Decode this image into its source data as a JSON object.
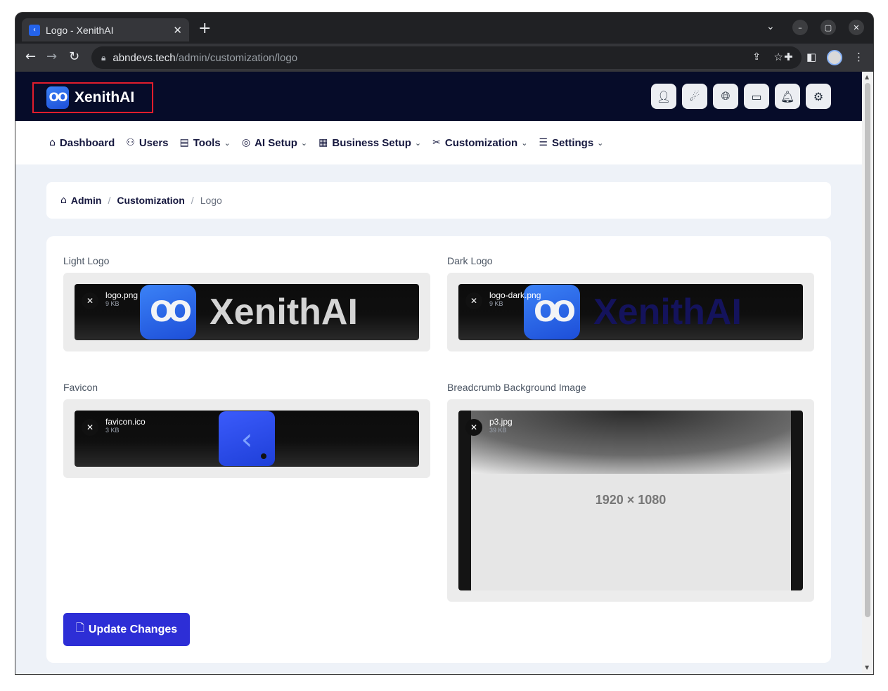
{
  "browser": {
    "tab_title": "Logo - XenithAI",
    "tab_close": "✕",
    "new_tab": "+",
    "url_host": "abndevs.tech",
    "url_path": "/admin/customization/logo"
  },
  "app": {
    "brand_mark": "OO",
    "brand_name": "XenithAI",
    "header_icons": [
      "user-icon",
      "theme-icon",
      "globe-icon",
      "currency-icon",
      "bell-icon",
      "user-settings-icon"
    ]
  },
  "nav": {
    "items": [
      {
        "label": "Dashboard",
        "icon": "home-icon",
        "dropdown": false
      },
      {
        "label": "Users",
        "icon": "users-icon",
        "dropdown": false
      },
      {
        "label": "Tools",
        "icon": "briefcase-icon",
        "dropdown": true
      },
      {
        "label": "AI Setup",
        "icon": "gauge-icon",
        "dropdown": true
      },
      {
        "label": "Business Setup",
        "icon": "building-icon",
        "dropdown": true
      },
      {
        "label": "Customization",
        "icon": "tools-icon",
        "dropdown": true
      },
      {
        "label": "Settings",
        "icon": "sliders-icon",
        "dropdown": true
      }
    ]
  },
  "breadcrumb": {
    "admin": "Admin",
    "customization": "Customization",
    "current": "Logo",
    "separator": "/"
  },
  "form": {
    "light_logo": {
      "label": "Light Logo",
      "file_name": "logo.png",
      "file_size": "9 KB",
      "preview_text": "XenithAI"
    },
    "dark_logo": {
      "label": "Dark Logo",
      "file_name": "logo-dark.png",
      "file_size": "9 KB",
      "preview_text": "XenithAI"
    },
    "favicon": {
      "label": "Favicon",
      "file_name": "favicon.ico",
      "file_size": "3 KB"
    },
    "breadcrumb_bg": {
      "label": "Breadcrumb Background Image",
      "file_name": "p3.jpg",
      "file_size": "39 KB",
      "placeholder_text": "1920 × 1080"
    },
    "remove_symbol": "✕",
    "submit_label": "Update Changes"
  },
  "colors": {
    "header_bg": "#060c29",
    "accent": "#2d2ed6",
    "page_bg": "#eef2f8",
    "brand_blue": "#1d4ed8"
  }
}
